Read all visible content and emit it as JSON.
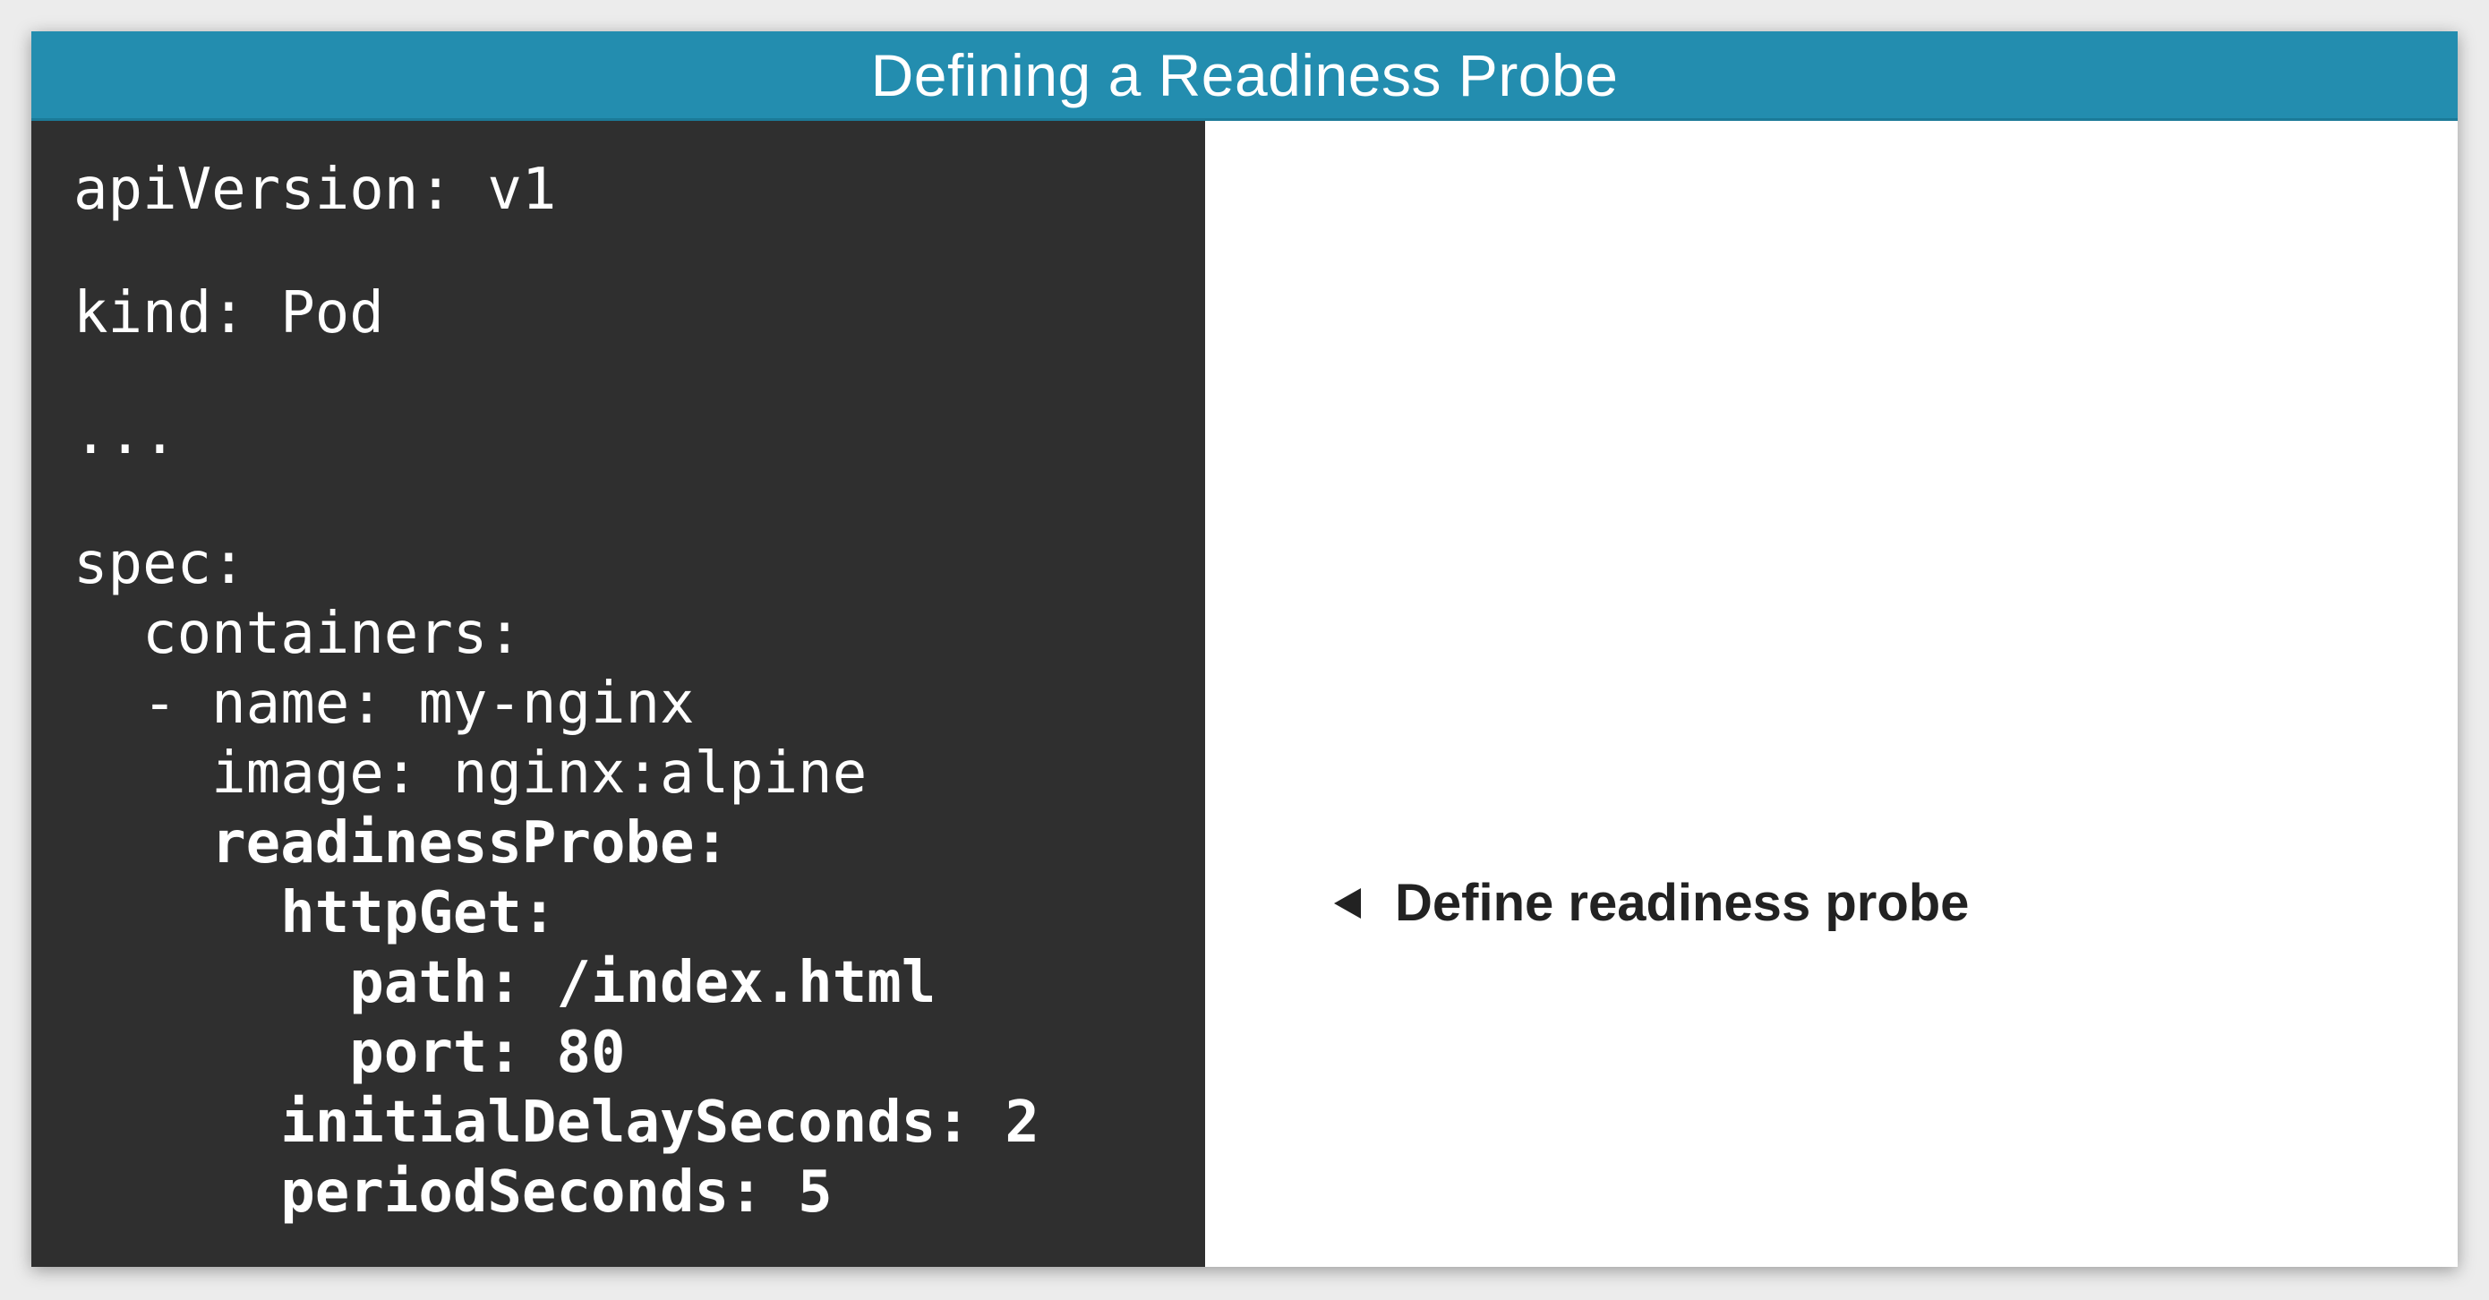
{
  "slide": {
    "title": "Defining a Readiness Probe"
  },
  "code": {
    "lines": [
      "apiVersion: v1",
      "kind: Pod",
      "...",
      "spec:",
      "  containers:",
      "  - name: my-nginx",
      "    image: nginx:alpine",
      "    readinessProbe:",
      "      httpGet:",
      "        path: /index.html",
      "        port: 80",
      "      initialDelaySeconds: 2",
      "      periodSeconds: 5"
    ]
  },
  "annotation": {
    "text": "Define readiness probe",
    "icon": "left-triangle-arrow-icon"
  },
  "colors": {
    "title_bar": "#238daf",
    "code_background": "#2f2f2f",
    "code_text": "#ffffff",
    "annotation_text": "#222222"
  }
}
